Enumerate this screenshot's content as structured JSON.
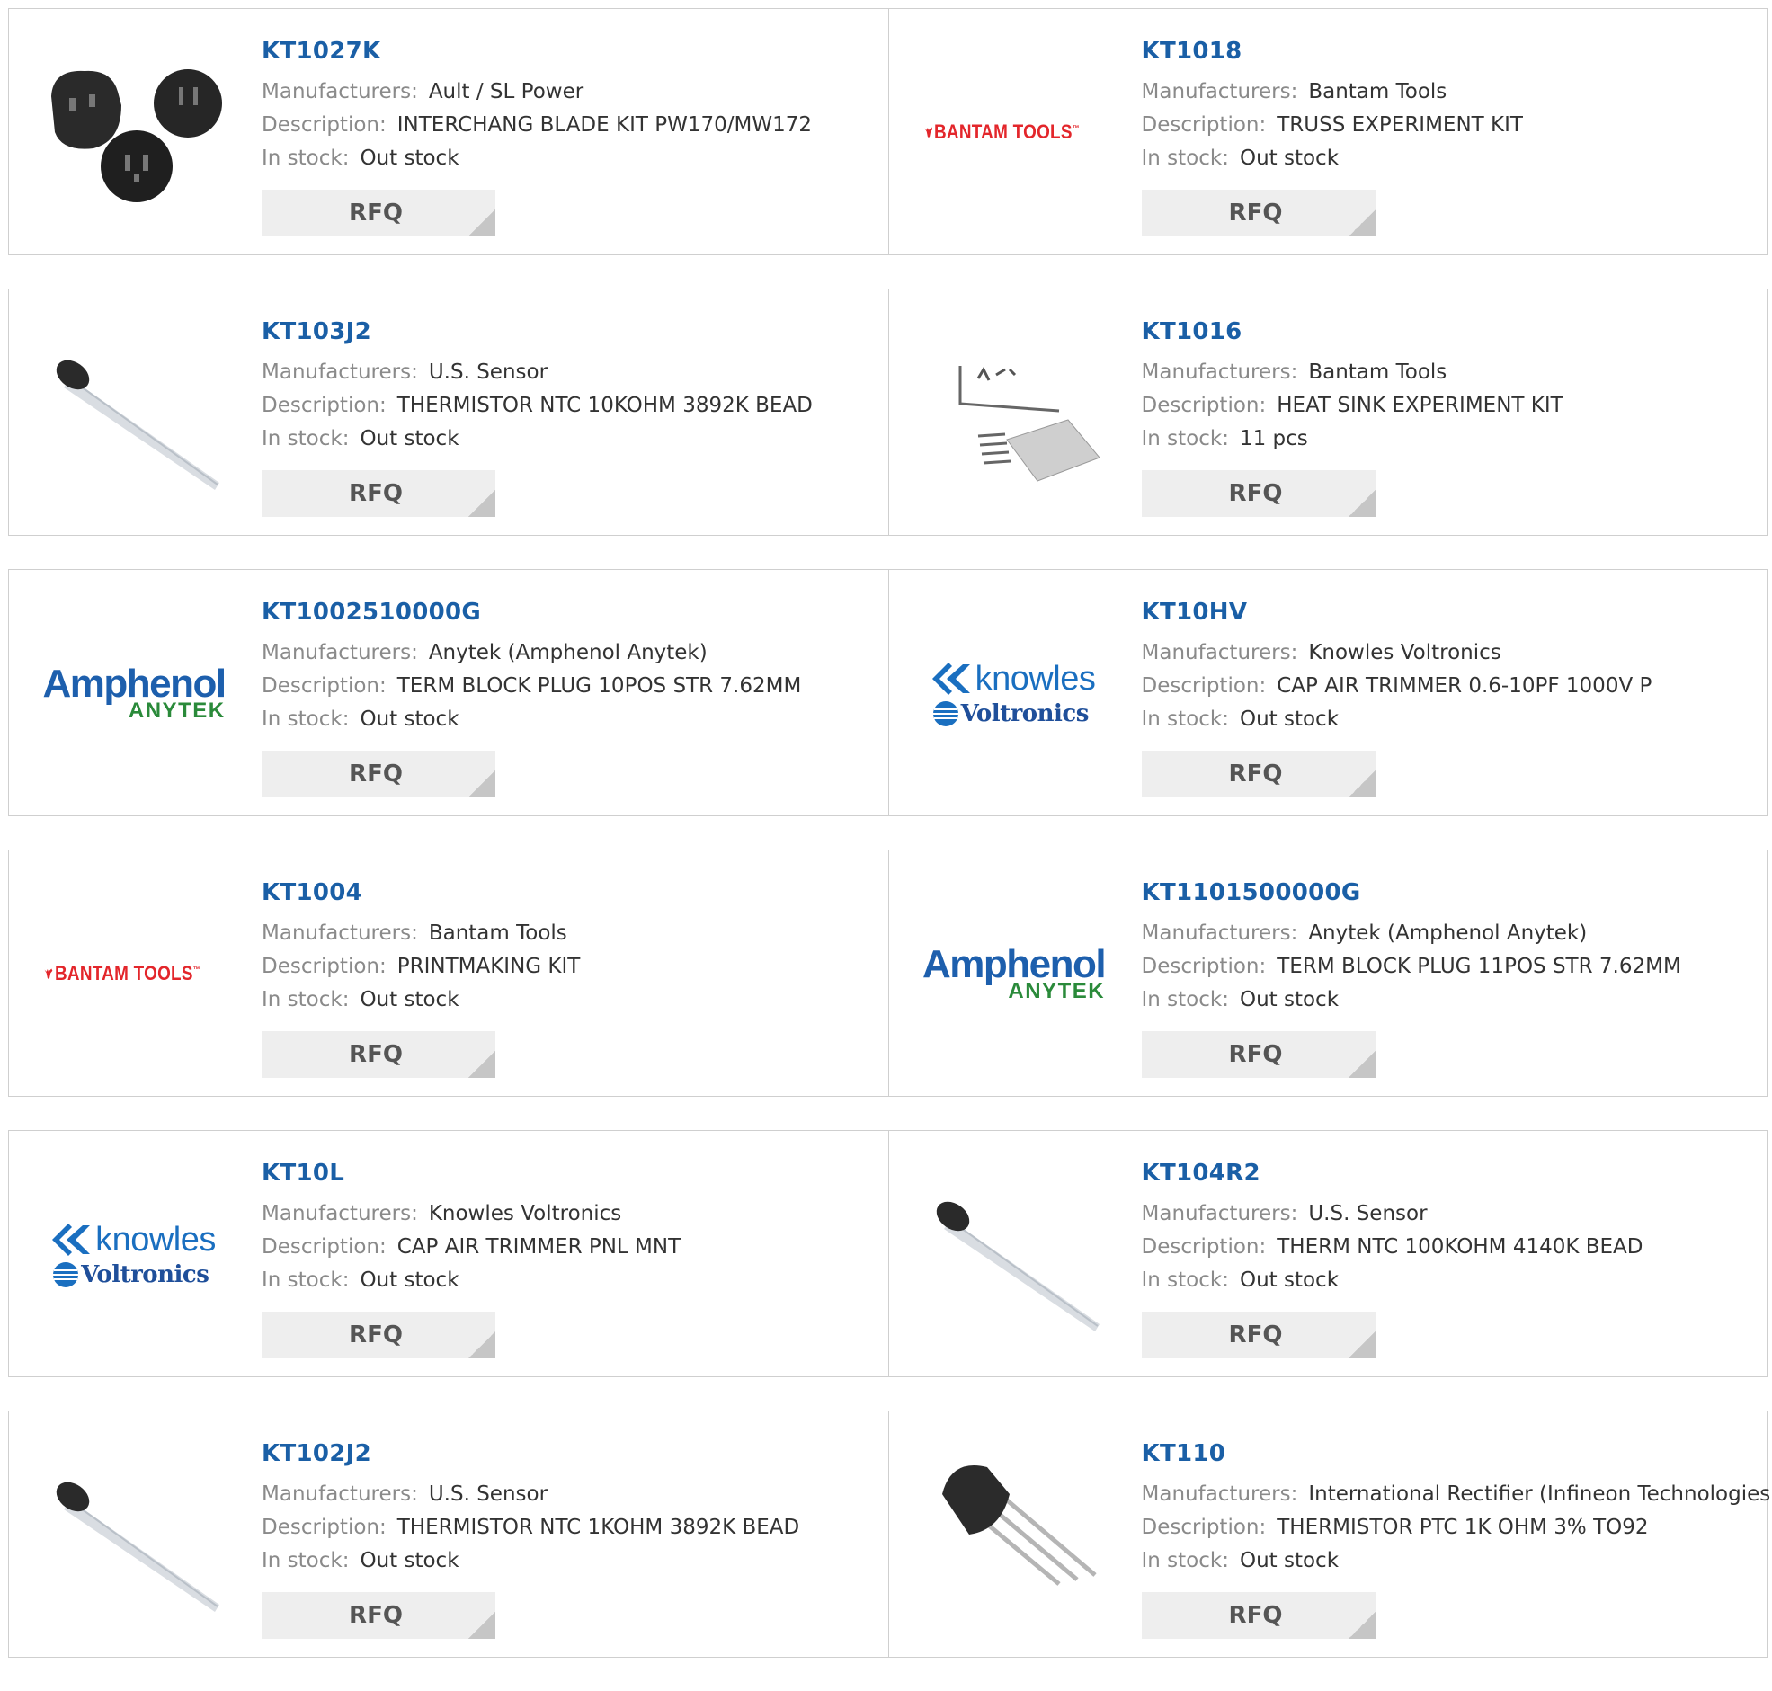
{
  "labels": {
    "manufacturers": "Manufacturers:",
    "description": "Description:",
    "in_stock": "In stock:",
    "rfq": "RFQ"
  },
  "brand_colors": {
    "link": "#1a5fa6",
    "bantam_red": "#e3262b",
    "amphenol_blue": "#1d5fad",
    "anytek_green": "#2a8a3a",
    "knowles_blue": "#1a6fc0"
  },
  "products": [
    {
      "part": "KT1027K",
      "manufacturer": "Ault / SL Power",
      "description": "INTERCHANG BLADE KIT PW170/MW172",
      "stock": "Out stock",
      "image": "plug-adapters-photo"
    },
    {
      "part": "KT1018",
      "manufacturer": "Bantam Tools",
      "description": "TRUSS EXPERIMENT KIT",
      "stock": "Out stock",
      "image": "bantam-tools-logo",
      "logo_text": "BANTAM TOOLS",
      "logo_mark": "™"
    },
    {
      "part": "KT103J2",
      "manufacturer": "U.S. Sensor",
      "description": "THERMISTOR NTC 10KOHM 3892K BEAD",
      "stock": "Out stock",
      "image": "thermistor-bead-photo"
    },
    {
      "part": "KT1016",
      "manufacturer": "Bantam Tools",
      "description": "HEAT SINK EXPERIMENT KIT",
      "stock": "11 pcs",
      "image": "heat-sink-kit-photo"
    },
    {
      "part": "KT1002510000G",
      "manufacturer": "Anytek (Amphenol Anytek)",
      "description": "TERM BLOCK PLUG 10POS STR 7.62MM",
      "stock": "Out stock",
      "image": "amphenol-anytek-logo",
      "logo_text": "Amphenol",
      "logo_sub": "ANYTEK"
    },
    {
      "part": "KT10HV",
      "manufacturer": "Knowles Voltronics",
      "description": "CAP AIR TRIMMER 0.6-10PF 1000V P",
      "stock": "Out stock",
      "image": "knowles-voltronics-logo",
      "logo_text": "knowles",
      "logo_sub": "Voltronics"
    },
    {
      "part": "KT1004",
      "manufacturer": "Bantam Tools",
      "description": "PRINTMAKING KIT",
      "stock": "Out stock",
      "image": "bantam-tools-logo",
      "logo_text": "BANTAM TOOLS",
      "logo_mark": "™"
    },
    {
      "part": "KT1101500000G",
      "manufacturer": "Anytek (Amphenol Anytek)",
      "description": "TERM BLOCK PLUG 11POS STR 7.62MM",
      "stock": "Out stock",
      "image": "amphenol-anytek-logo",
      "logo_text": "Amphenol",
      "logo_sub": "ANYTEK"
    },
    {
      "part": "KT10L",
      "manufacturer": "Knowles Voltronics",
      "description": "CAP AIR TRIMMER PNL MNT",
      "stock": "Out stock",
      "image": "knowles-voltronics-logo",
      "logo_text": "knowles",
      "logo_sub": "Voltronics"
    },
    {
      "part": "KT104R2",
      "manufacturer": "U.S. Sensor",
      "description": "THERM NTC 100KOHM 4140K BEAD",
      "stock": "Out stock",
      "image": "thermistor-bead-photo"
    },
    {
      "part": "KT102J2",
      "manufacturer": "U.S. Sensor",
      "description": "THERMISTOR NTC 1KOHM 3892K BEAD",
      "stock": "Out stock",
      "image": "thermistor-bead-photo"
    },
    {
      "part": "KT110",
      "manufacturer": "International Rectifier (Infineon Technologies)",
      "description": "THERMISTOR PTC 1K OHM 3% TO92",
      "stock": "Out stock",
      "image": "to92-component-photo"
    }
  ]
}
